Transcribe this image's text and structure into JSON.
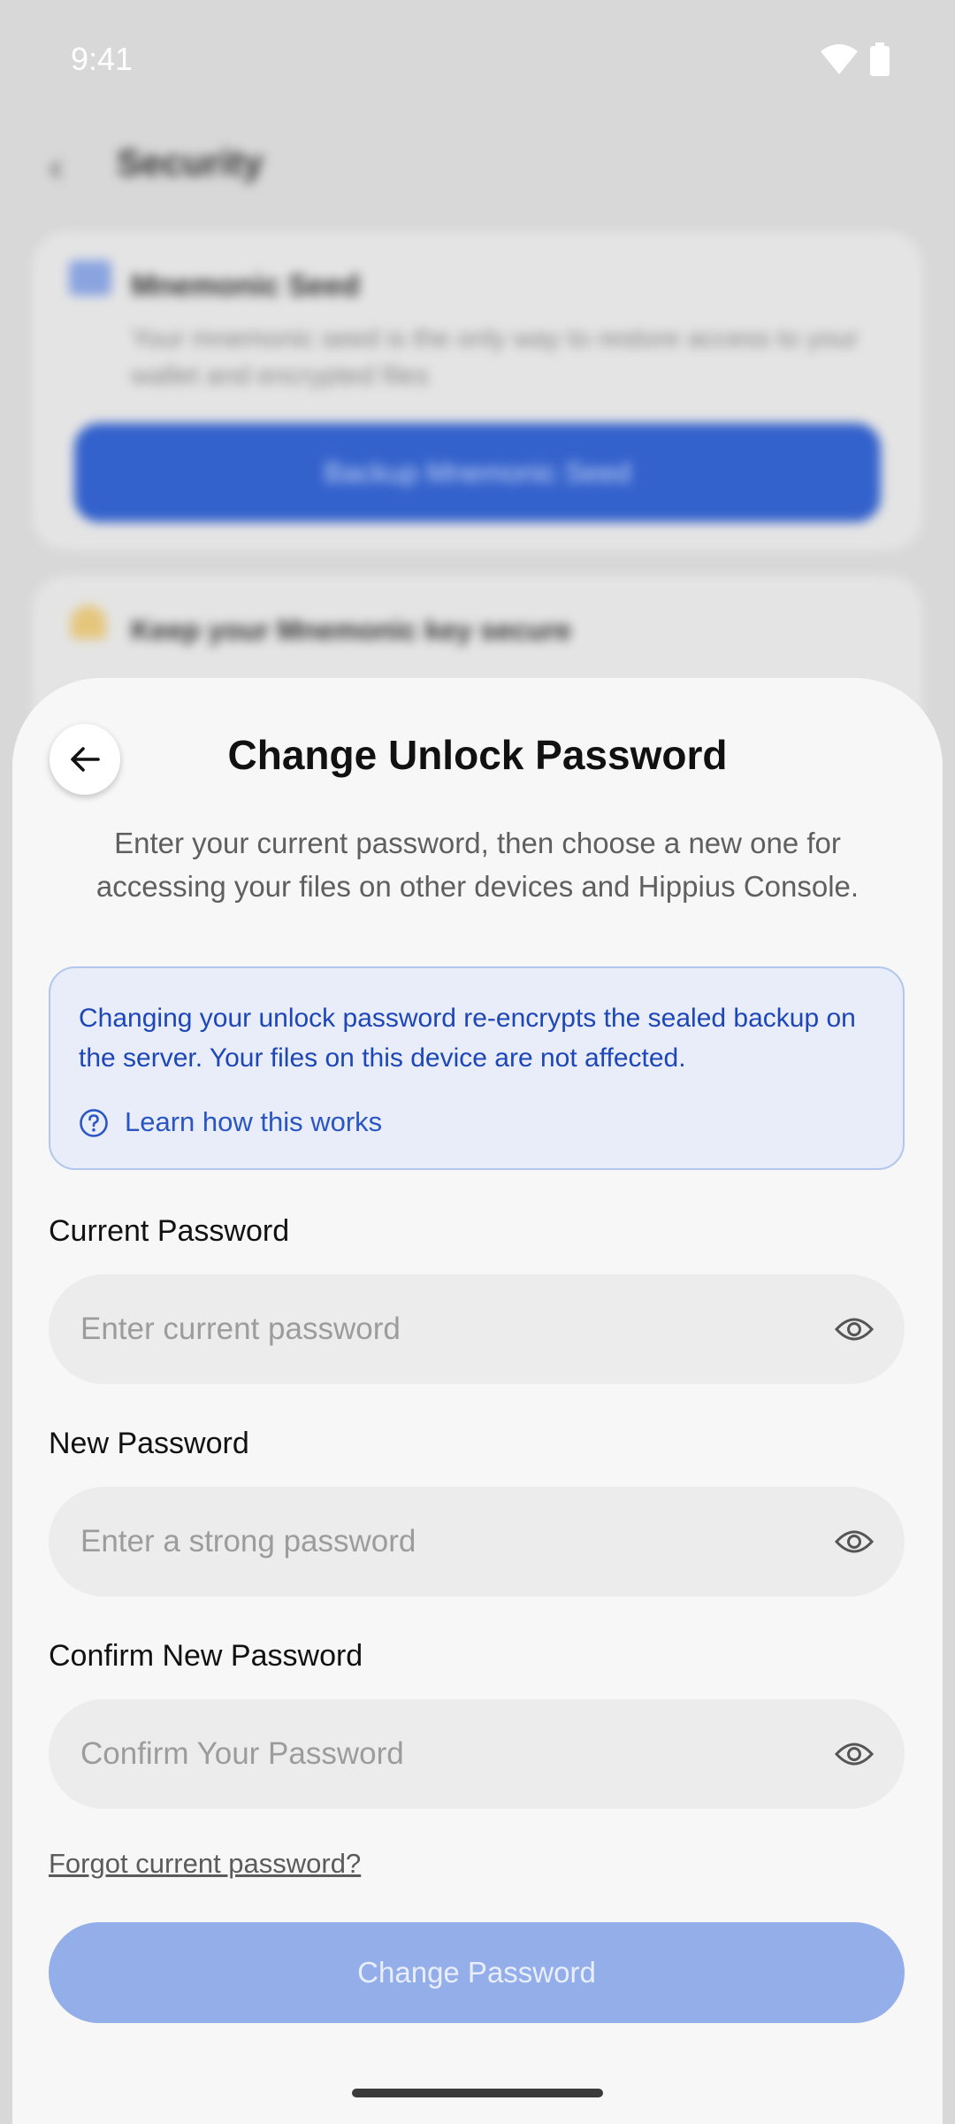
{
  "status_bar": {
    "time": "9:41"
  },
  "background_page": {
    "header_title": "Security",
    "card1": {
      "title": "Mnemonic Seed",
      "description": "Your mnemonic seed is the only way to restore access to your wallet and encrypted files",
      "button_label": "Backup Mnemonic Seed"
    },
    "card2": {
      "title": "Keep your Mnemonic key secure"
    }
  },
  "sheet": {
    "title": "Change Unlock Password",
    "subtitle": "Enter your current password, then choose a new one for accessing your files on other devices and Hippius Console.",
    "info": {
      "text": "Changing your unlock password re-encrypts the sealed backup on the server. Your files on this device are not affected.",
      "link_label": "Learn how this works"
    },
    "fields": {
      "current": {
        "label": "Current Password",
        "placeholder": "Enter current password"
      },
      "new": {
        "label": "New Password",
        "placeholder": "Enter a strong password"
      },
      "confirm": {
        "label": "Confirm New Password",
        "placeholder": "Confirm Your Password"
      }
    },
    "forgot_label": "Forgot current password?",
    "submit_label": "Change Password"
  },
  "colors": {
    "accent": "#1d47b8",
    "info_bg": "#e8edf9",
    "button_disabled": "#94aeea",
    "background_button": "#3462cc"
  },
  "icons": {
    "back": "arrow-left-icon",
    "help": "question-circle-icon",
    "reveal": "eye-icon",
    "wifi": "wifi-icon",
    "battery": "battery-icon"
  }
}
